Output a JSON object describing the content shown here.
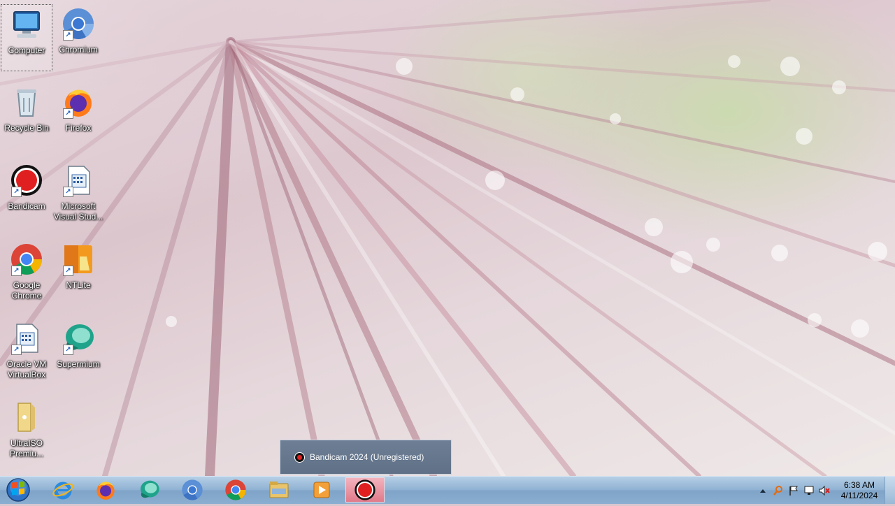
{
  "desktop_icons": [
    {
      "id": "computer",
      "label": "Computer"
    },
    {
      "id": "chromium",
      "label": "Chromium"
    },
    {
      "id": "recycle-bin",
      "label": "Recycle Bin"
    },
    {
      "id": "firefox",
      "label": "Firefox"
    },
    {
      "id": "bandicam",
      "label": "Bandicam"
    },
    {
      "id": "visual-studio",
      "label": "Microsoft Visual Stud..."
    },
    {
      "id": "google-chrome",
      "label": "Google Chrome"
    },
    {
      "id": "ntlite",
      "label": "NTLite"
    },
    {
      "id": "virtualbox",
      "label": "Oracle VM VirtualBox"
    },
    {
      "id": "supermium",
      "label": "Supermium"
    },
    {
      "id": "ultraiso",
      "label": "UltraISO Premiu..."
    }
  ],
  "tooltip": {
    "text": "Bandicam 2024 (Unregistered)"
  },
  "taskbar": {
    "pinned": [
      "internet-explorer",
      "firefox",
      "supermium",
      "chromium",
      "google-chrome",
      "file-explorer",
      "media-player",
      "bandicam"
    ],
    "active": "bandicam"
  },
  "clock": {
    "time": "6:38 AM",
    "date": "4/11/2024"
  },
  "colors": {
    "taskbar": "#8fb2d3",
    "accent_red": "#e02020",
    "active_button": "#e07a8a"
  }
}
